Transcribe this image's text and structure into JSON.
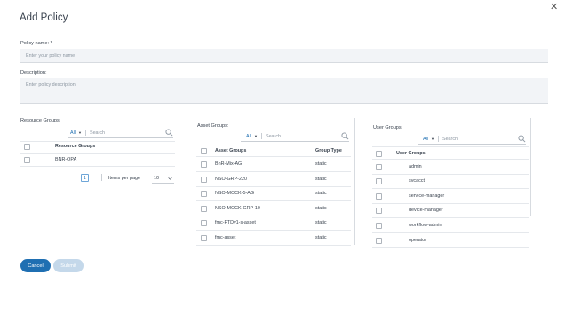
{
  "dialog": {
    "title": "Add Policy",
    "close_icon": "close-icon"
  },
  "policy_name": {
    "label": "Policy name: *",
    "placeholder": "Enter your policy name",
    "value": ""
  },
  "description": {
    "label": "Description:",
    "placeholder": "Enter policy description",
    "value": ""
  },
  "resource_groups": {
    "label": "Resource Groups:",
    "filter_all": "All",
    "search_placeholder": "Search",
    "header": "Resource Groups",
    "rows": [
      "BNR-OPA"
    ],
    "pagination": {
      "page": "1",
      "items_per_page_label": "Items per page",
      "items_per_page": "10"
    }
  },
  "asset_groups": {
    "label": "Asset Groups:",
    "filter_all": "All",
    "search_placeholder": "Search",
    "headers": [
      "Asset Groups",
      "Group Type"
    ],
    "rows": [
      {
        "name": "BnR-Mix-AG",
        "type": "static"
      },
      {
        "name": "NSO-GRP-220",
        "type": "static"
      },
      {
        "name": "NSO-MOCK-5-AG",
        "type": "static"
      },
      {
        "name": "NSO-MOCK-GRP-10",
        "type": "static"
      },
      {
        "name": "fmc-FTDv1-s-asset",
        "type": "static"
      },
      {
        "name": "fmc-asset",
        "type": "static"
      }
    ]
  },
  "user_groups": {
    "label": "User Groups:",
    "filter_all": "All",
    "search_placeholder": "Search",
    "header": "User Groups",
    "rows": [
      "admin",
      "svcacct",
      "service-manager",
      "device-manager",
      "workflow-admin",
      "operator"
    ]
  },
  "footer": {
    "cancel": "Cancel",
    "submit": "Submit"
  },
  "colors": {
    "primary": "#1f6fb2",
    "disabled_button": "#c4d8ea",
    "field_background": "#f2f4f7"
  }
}
